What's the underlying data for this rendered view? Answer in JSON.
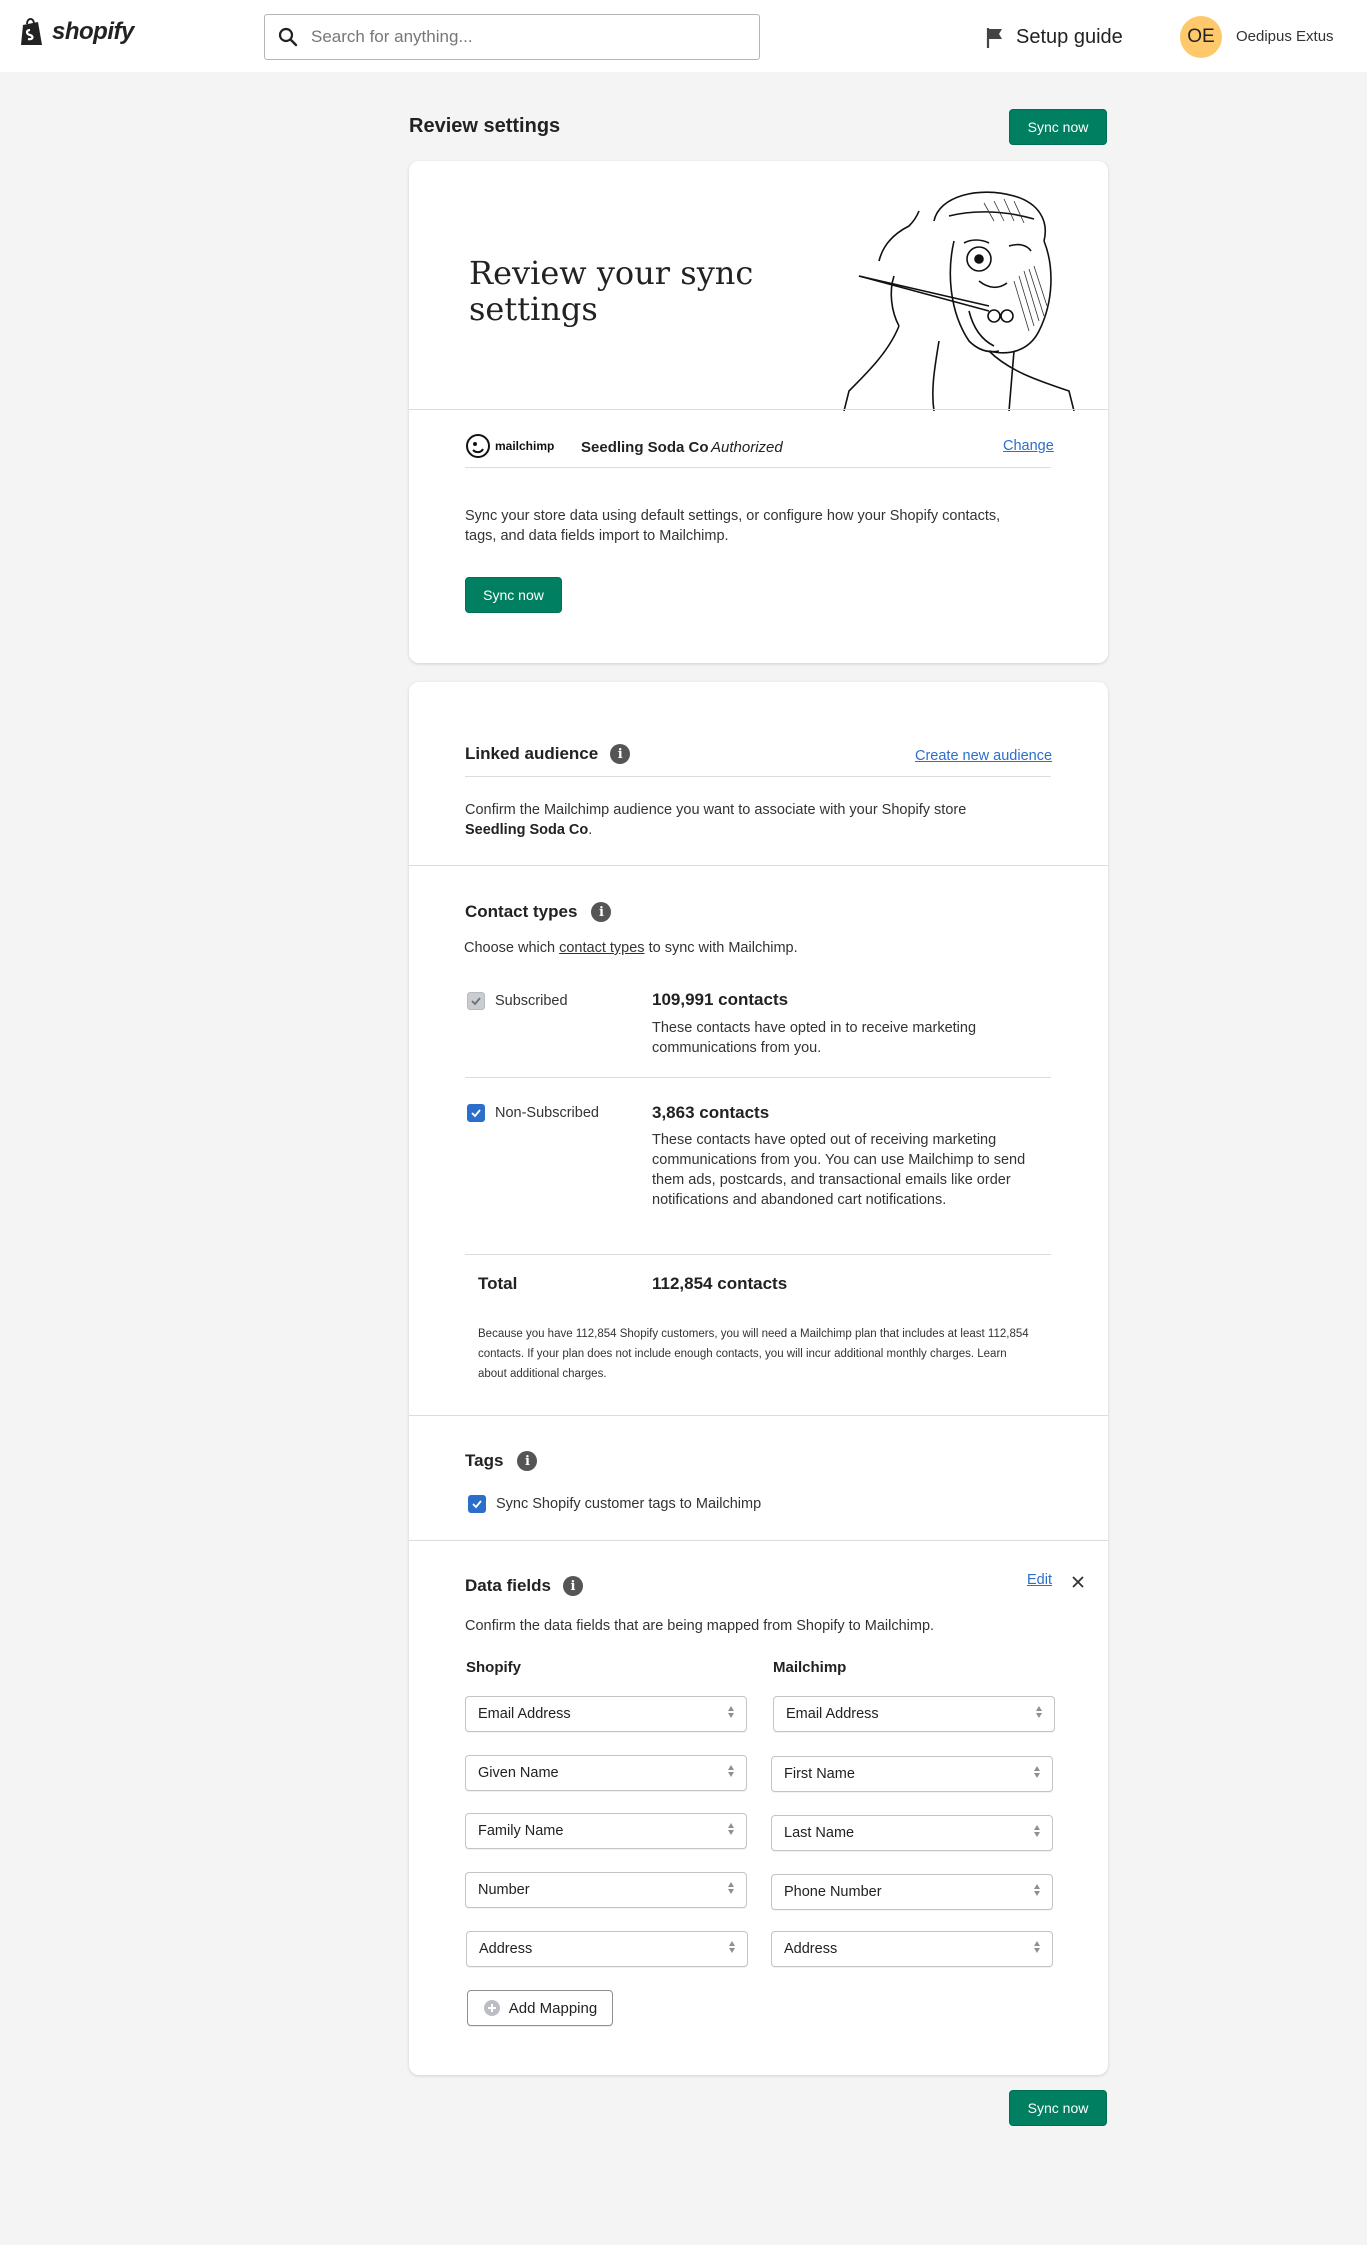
{
  "topbar": {
    "logo_text": "shopify",
    "search_placeholder": "Search for anything...",
    "setup_guide": "Setup guide",
    "avatar_initials": "OE",
    "username": "Oedipus Extus"
  },
  "page": {
    "title": "Review settings",
    "sync_label": "Sync now"
  },
  "hero": {
    "title": "Review your sync settings",
    "connection": {
      "provider": "mailchimp",
      "store": "Seedling Soda Co",
      "status": "Authorized",
      "change": "Change"
    },
    "description": "Sync your store data using default settings, or configure how your Shopify contacts, tags, and data fields import to Mailchimp.",
    "sync_label": "Sync now"
  },
  "linked_audience": {
    "title": "Linked audience",
    "create_link": "Create new audience",
    "desc_prefix": "Confirm the Mailchimp audience you want to associate with your Shopify store",
    "desc_store": "Seedling Soda Co",
    "desc_suffix": "."
  },
  "contact_types": {
    "title": "Contact types",
    "intro_prefix": "Choose which",
    "intro_link": "contact types",
    "intro_suffix": "to sync with Mailchimp.",
    "rows": [
      {
        "label": "Subscribed",
        "count": "109,991 contacts",
        "desc": "These contacts have opted in to receive marketing communications from you.",
        "state": "disabled-checked"
      },
      {
        "label": "Non-Subscribed",
        "count": "3,863 contacts",
        "desc": "These contacts have opted out of receiving marketing communications from you. You can use Mailchimp to send them ads, postcards, and transactional emails like order notifications and abandoned cart notifications.",
        "state": "checked"
      }
    ],
    "total_label": "Total",
    "total_value": "112,854 contacts",
    "note": "Because you have 112,854 Shopify customers, you will need a Mailchimp plan that includes at least 112,854 contacts. If your plan does not include enough contacts, you will incur additional monthly charges. Learn about additional charges."
  },
  "tags": {
    "title": "Tags",
    "checkbox_label": "Sync Shopify customer tags to Mailchimp"
  },
  "data_fields": {
    "title": "Data fields",
    "edit": "Edit",
    "desc": "Confirm the data fields that are being mapped from Shopify to Mailchimp.",
    "col_shopify": "Shopify",
    "col_mailchimp": "Mailchimp",
    "mappings": [
      {
        "shopify": "Email Address",
        "mailchimp": "Email Address"
      },
      {
        "shopify": "Given Name",
        "mailchimp": "First Name"
      },
      {
        "shopify": "Family Name",
        "mailchimp": "Last Name"
      },
      {
        "shopify": "Number",
        "mailchimp": "Phone Number"
      },
      {
        "shopify": "Address",
        "mailchimp": "Address"
      }
    ],
    "add_mapping": "Add Mapping"
  },
  "footer": {
    "sync_label": "Sync now"
  },
  "colors": {
    "primary": "#008060",
    "link": "#2c6ecb",
    "avatar": "#ffc96b",
    "background": "#f4f4f4"
  }
}
